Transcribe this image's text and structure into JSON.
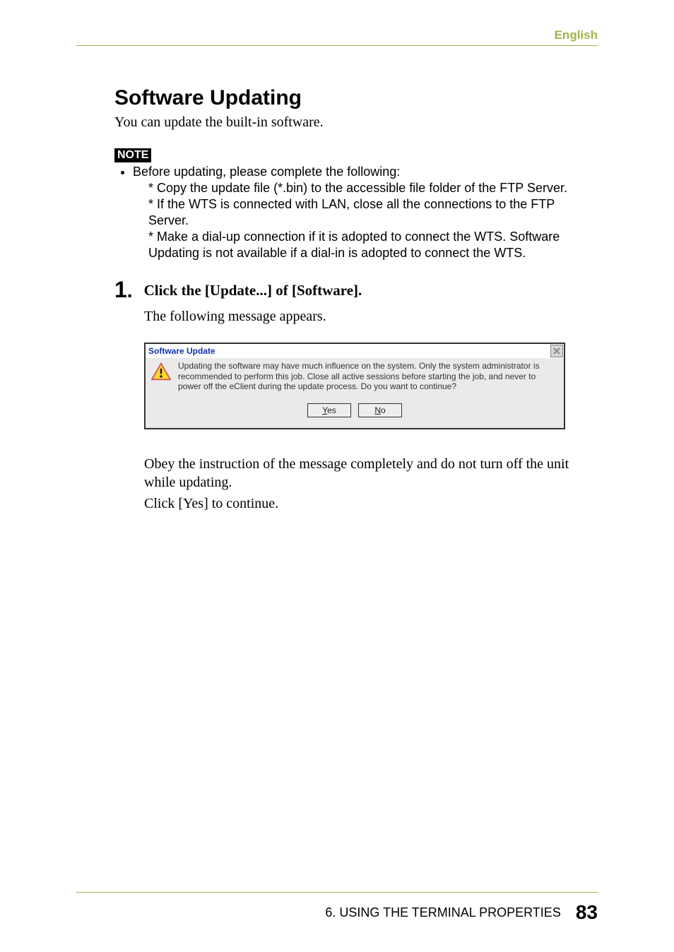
{
  "header": {
    "language": "English"
  },
  "section": {
    "title": "Software Updating",
    "intro": "You can update the built-in software."
  },
  "note": {
    "badge": "NOTE",
    "lead": "Before updating, please complete the following:",
    "items": [
      "* Copy the update file (*.bin) to the accessible file folder of the FTP Server.",
      "* If the WTS is connected with LAN, close all the connections to the FTP Server.",
      "* Make a dial-up connection if it is adopted to connect the WTS.  Software Updating is not available if a dial-in is adopted to connect the WTS."
    ]
  },
  "step1": {
    "number": "1",
    "dot": ".",
    "heading": "Click the [Update...] of [Software].",
    "following": "The following message appears.",
    "obey": "Obey the instruction of the message completely and do not turn off the unit while updating.",
    "click": "Click [Yes] to continue."
  },
  "dialog": {
    "title": "Software Update",
    "message": "Updating the software may have much influence on the system. Only the system administrator is recommended to perform this job. Close all active sessions before starting the job, and never to power off the eClient during the update process. Do you want to continue?",
    "yes_prefix": "Y",
    "yes_rest": "es",
    "no_prefix": "N",
    "no_rest": "o"
  },
  "footer": {
    "chapter": "6. USING THE TERMINAL PROPERTIES",
    "page": "83"
  }
}
